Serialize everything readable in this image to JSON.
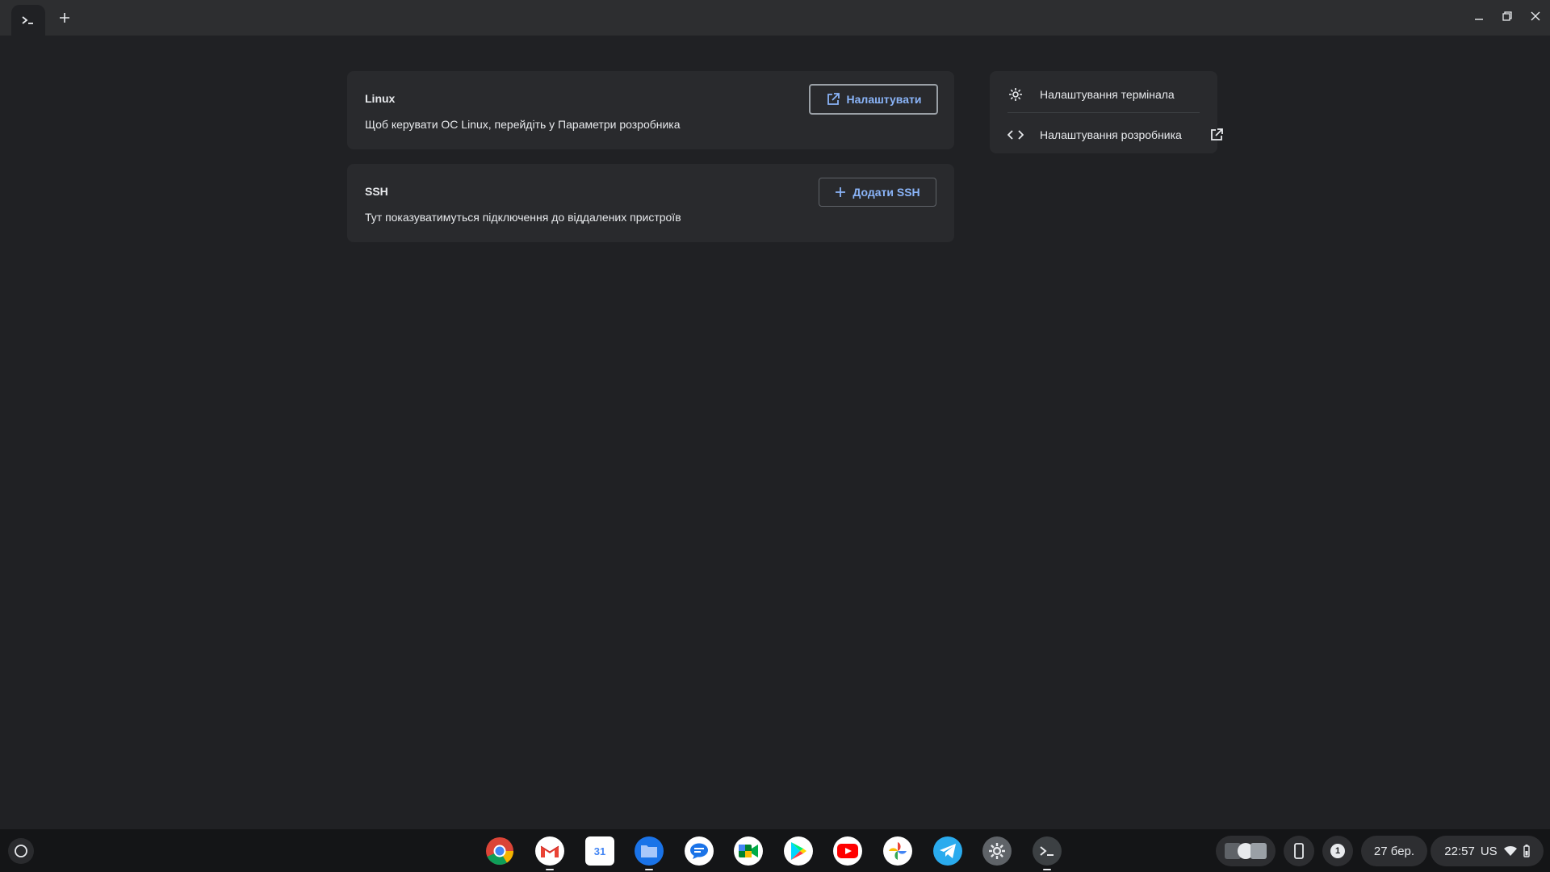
{
  "window": {
    "tab_icon": "terminal-prompt-icon",
    "new_tab_icon": "plus-icon",
    "controls": [
      "minimize-icon",
      "maximize-icon",
      "close-icon"
    ]
  },
  "linux_card": {
    "title": "Linux",
    "description": "Щоб керувати ОС Linux, перейдіть у Параметри розробника",
    "button_label": "Налаштувати",
    "button_icon": "open-external-icon"
  },
  "ssh_card": {
    "title": "SSH",
    "description": "Тут показуватимуться підключення до віддалених пристроїв",
    "button_label": "Додати SSH",
    "button_icon": "plus-icon"
  },
  "side_menu": {
    "items": [
      {
        "label": "Налаштування термінала",
        "icon": "gear-icon"
      },
      {
        "label": "Налаштування розробника",
        "icon": "code-brackets-icon",
        "trailing_icon": "open-external-icon"
      }
    ]
  },
  "shelf": {
    "apps": [
      {
        "name": "chrome",
        "running": false
      },
      {
        "name": "gmail",
        "running": true
      },
      {
        "name": "calendar",
        "label": "31",
        "running": false
      },
      {
        "name": "files",
        "running": true
      },
      {
        "name": "messages",
        "running": false
      },
      {
        "name": "meet",
        "running": false
      },
      {
        "name": "play-store",
        "running": false
      },
      {
        "name": "youtube",
        "running": false
      },
      {
        "name": "photos",
        "running": false
      },
      {
        "name": "telegram",
        "running": false
      },
      {
        "name": "settings",
        "running": false
      },
      {
        "name": "terminal",
        "running": true
      }
    ],
    "tray": {
      "notification_count": "1",
      "date": "27 бер.",
      "time": "22:57",
      "keyboard_layout": "US"
    }
  },
  "colors": {
    "background": "#202124",
    "card": "#292a2d",
    "accent": "#8ab4f8",
    "shelf": "#141517"
  }
}
